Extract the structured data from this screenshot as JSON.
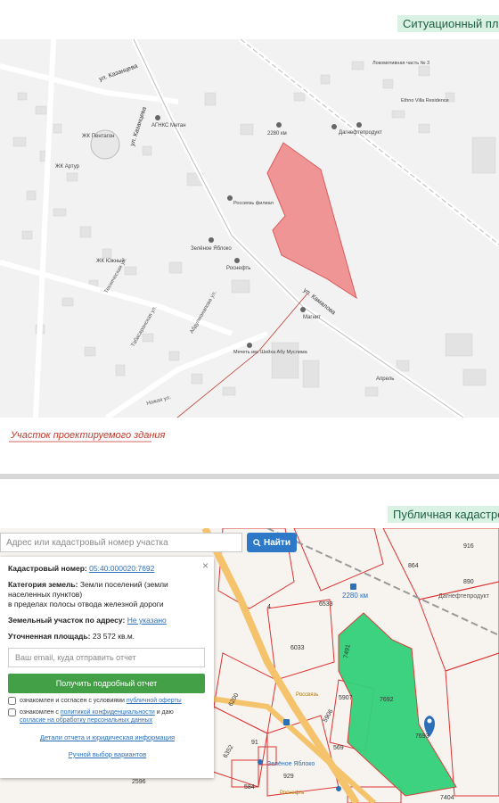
{
  "situational_plan": {
    "title": "Ситуационный пла",
    "caption": "Участок проектируемого здания",
    "labels": {
      "kazantseva": "ул. Казанцева",
      "kazantseva2": "ул. Казанцева",
      "kamalova": "ул. Камалова",
      "kamalova2": "ул. Камалова",
      "agnks": "АГНКС Метан",
      "pentagon": "ЖК Пентагон",
      "artur": "ЖК Артур",
      "yuzhny": "ЖК Южный",
      "km2280": "2280 км",
      "dagnefte": "Дагнефтепродукт",
      "rossvyaz": "Россвязь филиал",
      "zelenoe": "Зелёное Яблоко",
      "rosnefe": "Роснефть",
      "magnit": "Магнит",
      "mosque": "Мечеть им. Шейха Абу Муслима",
      "ethno": "Ethno Villa Residence",
      "lokomotiv": "Локомотивная часть № 3",
      "apteka": "Апрель",
      "nozhaya": "Ножая ул.",
      "abdulmanapov": "Абдулманапова ул.",
      "tabasaranskaya": "Табасаранская ул.",
      "tekhnicheskaya": "Техническая ул."
    }
  },
  "cadastral": {
    "title": "Публичная кадастро",
    "search": {
      "placeholder": "Адрес или кадастровый номер участка",
      "button": "Найти"
    },
    "panel": {
      "close": "×",
      "cad_label": "Кадастровый номер:",
      "cad_value": "05:40:000020:7692",
      "cat_label": "Категория земель:",
      "cat_value": "Земли поселений (земли населенных пунктов)",
      "cat_extra": "в пределах полосы отвода железной дороги",
      "addr_label": "Земельный участок по адресу:",
      "addr_value": "Не указано",
      "area_label": "Уточненная площадь:",
      "area_value": "23 572 кв.м.",
      "email_placeholder": "Ваш email, куда отправить отчет",
      "get_button": "Получить подробный отчет",
      "check1_text": "ознакомлен и согласен с условиями",
      "check1_link": "публичной оферты",
      "check2_text": "ознакомлен с",
      "check2_link": "политикой конфиденциальности",
      "check2_text2": "и даю",
      "check2_link2": "согласие на обработку персональных данных",
      "link_details": "Детали отчета и юридическая информация",
      "link_manual": "Ручной выбор вариантов"
    },
    "map_labels": {
      "km2280": "2280 км",
      "dagnefte": "Дагнефтепродукт",
      "zelenoe": "Зелёное Яблоко",
      "rossvyaz": "Россвязь",
      "roznefe": "Роснефть"
    },
    "parcel_numbers": [
      "916",
      "890",
      "864",
      "6533",
      "6033",
      "5907",
      "7692",
      "7693",
      "5906",
      "569",
      "7404",
      "929",
      "584",
      "91",
      "7491",
      "6352",
      "4",
      "2596",
      "6200"
    ]
  },
  "colors": {
    "plot_fill": "#f08c8c",
    "plot_stroke": "#d94a4a",
    "parcel_fill": "#33d17a",
    "parcel_stroke": "#d33",
    "title_bg": "#d9f2e3"
  }
}
